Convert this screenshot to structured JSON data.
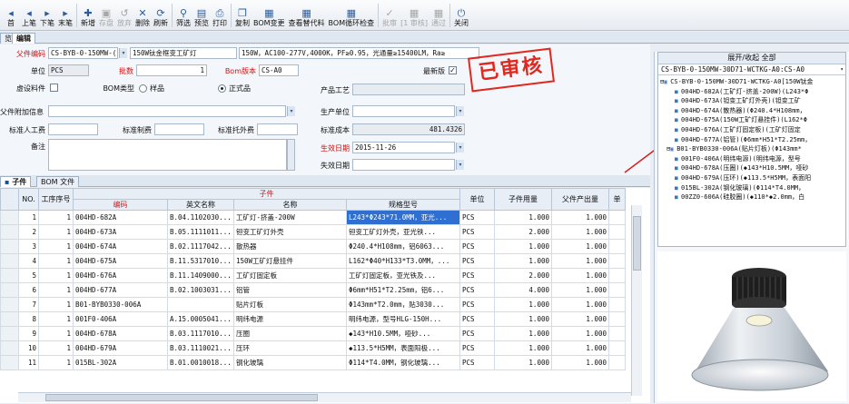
{
  "toolbar": [
    {
      "name": "tb-first",
      "icon": "◂",
      "label": "首",
      "enabled": true
    },
    {
      "name": "tb-prev",
      "icon": "◂",
      "label": "上笔",
      "enabled": true
    },
    {
      "name": "tb-next",
      "icon": "▸",
      "label": "下笔",
      "enabled": true
    },
    {
      "name": "tb-last",
      "icon": "▸",
      "label": "末笔",
      "enabled": true
    },
    {
      "name": "tb-new",
      "icon": "✚",
      "label": "新增",
      "enabled": true
    },
    {
      "name": "tb-save",
      "icon": "▣",
      "label": "存盘",
      "enabled": false
    },
    {
      "name": "tb-giveup",
      "icon": "↺",
      "label": "放弃",
      "enabled": false
    },
    {
      "name": "tb-delete",
      "icon": "✕",
      "label": "删除",
      "enabled": true
    },
    {
      "name": "tb-refresh",
      "icon": "⟳",
      "label": "刷新",
      "enabled": true
    },
    {
      "name": "tb-filter",
      "icon": "⚲",
      "label": "筛选",
      "enabled": true
    },
    {
      "name": "tb-preview",
      "icon": "▤",
      "label": "预览",
      "enabled": true
    },
    {
      "name": "tb-print",
      "icon": "⎙",
      "label": "打印",
      "enabled": true
    },
    {
      "name": "tb-copy",
      "icon": "❐",
      "label": "复制",
      "enabled": true
    },
    {
      "name": "tb-bom-change",
      "icon": "▦",
      "label": "BOM变更",
      "enabled": true
    },
    {
      "name": "tb-view-substitute",
      "icon": "▦",
      "label": "查看替代料",
      "enabled": true
    },
    {
      "name": "tb-bom-loop-check",
      "icon": "▦",
      "label": "BOM循环检查",
      "enabled": true
    },
    {
      "name": "tb-approve",
      "icon": "✓",
      "label": "批审",
      "enabled": false
    },
    {
      "name": "tb-review-level",
      "icon": "▦",
      "label": "[1 审核]",
      "enabled": false
    },
    {
      "name": "tb-pass",
      "icon": "▦",
      "label": "通过",
      "enabled": false
    },
    {
      "name": "tb-close",
      "icon": "⏻",
      "label": "关闭",
      "enabled": true
    }
  ],
  "tabs": {
    "left": "览",
    "active": "编辑"
  },
  "form": {
    "parent_code_label": "父件编码",
    "parent_code": "CS-BYB-0-150MW-(",
    "parent_name": "150W钛金框变工矿灯",
    "parent_spec": "150W，AC100-277V,4000K，PF≥0.95，光通量≥15400LM，Ra≥",
    "unit_label": "单位",
    "unit": "PCS",
    "batch_label": "批数",
    "batch": "1",
    "bom_version_label": "Bom版本",
    "bom_version": "CS-A0",
    "latest_label": "最新版",
    "latest_checked": "✓",
    "virtual_label": "虚设料件",
    "bom_type_label": "BOM类型",
    "bom_type_sample": "样品",
    "bom_type_formal": "正式品",
    "craft_label": "产品工艺",
    "parent_extra_label": "父件附加信息",
    "prod_unit_label": "生产单位",
    "std_labor_label": "标准人工费",
    "std_mfg_label": "标准制费",
    "std_outsource_label": "标准托外费",
    "std_cost_label": "标准成本",
    "std_cost": "481.4326",
    "remark_label": "备注",
    "effective_label": "生效日期",
    "effective": "2015-11-26",
    "expire_label": "失效日期"
  },
  "stamp": "已审核",
  "subtabs": {
    "active": "子件",
    "other": "BOM 文件"
  },
  "grid": {
    "header_group": "子件",
    "columns": [
      "NO.",
      "工序序号",
      "编码",
      "英文名称",
      "名称",
      "规格型号",
      "单位",
      "子件用量",
      "父件产出量",
      "单"
    ],
    "rows": [
      {
        "no": "1",
        "seq": "1",
        "code": "004HD-682A",
        "en": "B.04.1102030...",
        "name": "工矿灯-挤盖-200W",
        "spec": "L243*Φ243*71.0MM，亚光...",
        "unit": "PCS",
        "qty": "1.000",
        "out": "1.000"
      },
      {
        "no": "2",
        "seq": "1",
        "code": "004HD-673A",
        "en": "B.05.1111011...",
        "name": "钽变工矿灯外壳",
        "spec": "钽变工矿灯外壳，亚光铁...",
        "unit": "PCS",
        "qty": "2.000",
        "out": "1.000"
      },
      {
        "no": "3",
        "seq": "1",
        "code": "004HD-674A",
        "en": "B.02.1117042...",
        "name": "散热器",
        "spec": "Φ240.4*H108mm，铝6063...",
        "unit": "PCS",
        "qty": "1.000",
        "out": "1.000"
      },
      {
        "no": "4",
        "seq": "1",
        "code": "004HD-675A",
        "en": "B.11.5317010...",
        "name": "150W工矿灯悬挂件",
        "spec": "L162*Φ40*H133*T3.0MM，...",
        "unit": "PCS",
        "qty": "1.000",
        "out": "1.000"
      },
      {
        "no": "5",
        "seq": "1",
        "code": "004HD-676A",
        "en": "B.11.1409000...",
        "name": "工矿灯固定板",
        "spec": "工矿灯固定板，亚光铁及...",
        "unit": "PCS",
        "qty": "2.000",
        "out": "1.000"
      },
      {
        "no": "6",
        "seq": "1",
        "code": "004HD-677A",
        "en": "B.02.1003031...",
        "name": "铝管",
        "spec": "Φ6mm*H51*T2.25mm，铝6...",
        "unit": "PCS",
        "qty": "4.000",
        "out": "1.000"
      },
      {
        "no": "7",
        "seq": "1",
        "code": "B01-BYB0330-006A",
        "en": "",
        "name": "贴片灯板",
        "spec": "Φ143mm*T2.0mm，贴3030...",
        "unit": "PCS",
        "qty": "1.000",
        "out": "1.000"
      },
      {
        "no": "8",
        "seq": "1",
        "code": "001F0-406A",
        "en": "A.15.0005041...",
        "name": "明纬电源",
        "spec": "明纬电源，型号HLG-150H...",
        "unit": "PCS",
        "qty": "1.000",
        "out": "1.000"
      },
      {
        "no": "9",
        "seq": "1",
        "code": "004HD-678A",
        "en": "B.03.1117010...",
        "name": "压圈",
        "spec": "◆143*H10.5MM，哑砂...",
        "unit": "PCS",
        "qty": "1.000",
        "out": "1.000"
      },
      {
        "no": "10",
        "seq": "1",
        "code": "004HD-679A",
        "en": "B.03.1110021...",
        "name": "压环",
        "spec": "◆113.5*H5MM，表面阳极...",
        "unit": "PCS",
        "qty": "1.000",
        "out": "1.000"
      },
      {
        "no": "11",
        "seq": "1",
        "code": "015BL-302A",
        "en": "B.01.0010018...",
        "name": "钢化玻璃",
        "spec": "Φ114*T4.0MM，钢化玻璃...",
        "unit": "PCS",
        "qty": "1.000",
        "out": "1.000"
      }
    ]
  },
  "tree": {
    "header": "展开/收起 全部",
    "root": "CS-BYB-0-150MW-30D71-WCTKG-A0:CS-A0",
    "nodes": [
      {
        "text": "CS-BYB-0-150MW-30D71-WCTKG-A0[150W钛金",
        "level": 0,
        "icon": "▣"
      },
      {
        "text": "004HD-682A(工矿灯-挤盖-200W)(L243*Φ",
        "level": 1,
        "icon": "■"
      },
      {
        "text": "004HD-673A(钽变工矿灯外壳)(钽变工矿",
        "level": 1,
        "icon": "■"
      },
      {
        "text": "004HD-674A(散热器)(Φ240.4*H108mm，",
        "level": 1,
        "icon": "■"
      },
      {
        "text": "004HD-675A(150W工矿灯悬挂件)(L162*Φ",
        "level": 1,
        "icon": "■"
      },
      {
        "text": "004HD-676A(工矿灯固定板)(工矿灯固定",
        "level": 1,
        "icon": "■"
      },
      {
        "text": "004HD-677A(铝管)(Φ6mm*H51*T2.25mm，",
        "level": 1,
        "icon": "■"
      },
      {
        "text": "B01-BYB0330-006A(贴片灯板)(Φ143mm*",
        "level": 1,
        "icon": "▣"
      },
      {
        "text": "001F0-406A(明纬电源)(明纬电源，型号",
        "level": 1,
        "icon": "■"
      },
      {
        "text": "004HD-678A(压圈)(◆143*H10.5MM，哑砂",
        "level": 1,
        "icon": "■"
      },
      {
        "text": "004HD-679A(压环)(◆113.5*H5MM，表面阳",
        "level": 1,
        "icon": "■"
      },
      {
        "text": "015BL-302A(钢化玻璃)(Φ114*T4.0MM，",
        "level": 1,
        "icon": "■"
      },
      {
        "text": "00ZZ0-606A(硅胶圈)(◆110*◆2.0mm，白",
        "level": 1,
        "icon": "■"
      }
    ]
  }
}
